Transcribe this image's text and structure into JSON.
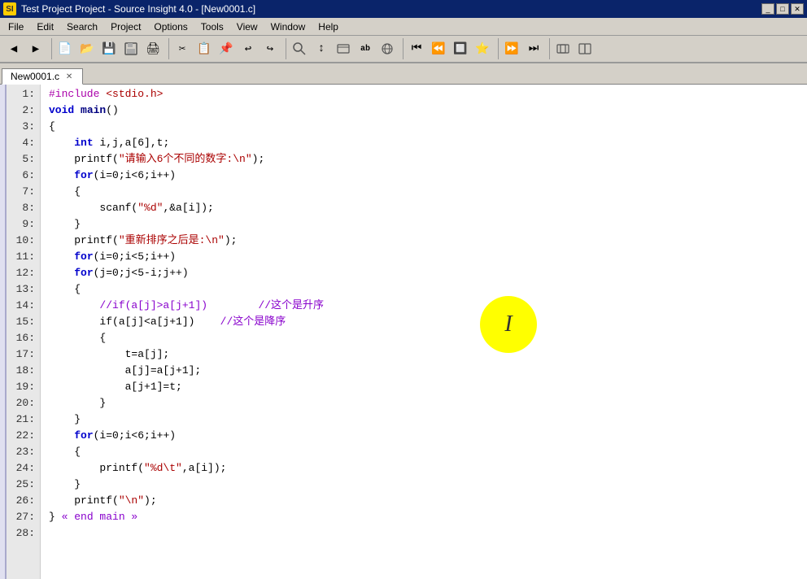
{
  "window": {
    "title": "Test Project Project - Source Insight 4.0 - [New0001.c]",
    "icon_label": "SI"
  },
  "menu": {
    "items": [
      "File",
      "Edit",
      "Search",
      "Project",
      "Options",
      "Tools",
      "View",
      "Window",
      "Help"
    ]
  },
  "tabs": [
    {
      "label": "New0001.c",
      "active": true
    }
  ],
  "toolbar": {
    "groups": [
      [
        "←",
        "→"
      ],
      [
        "📄",
        "📂",
        "💾",
        "📋",
        "🖨"
      ],
      [
        "✂",
        "📑",
        "📋",
        "↩",
        "↪"
      ],
      [
        "🔍",
        "↕",
        "📦",
        "ab",
        "🌐"
      ],
      [
        "⏮",
        "⏪",
        "🔲",
        "⭐",
        "⏭",
        "⏩"
      ]
    ]
  },
  "code": {
    "lines": [
      {
        "num": "1:",
        "tokens": [
          {
            "t": "#include ",
            "c": "macro"
          },
          {
            "t": "<stdio.h>",
            "c": "include-text"
          }
        ]
      },
      {
        "num": "2:",
        "tokens": [
          {
            "t": "void ",
            "c": "kw"
          },
          {
            "t": "main",
            "c": "fn"
          },
          {
            "t": "()",
            "c": "plain"
          }
        ]
      },
      {
        "num": "3:",
        "tokens": [
          {
            "t": "{",
            "c": "plain"
          }
        ]
      },
      {
        "num": "4:",
        "tokens": [
          {
            "t": "    int ",
            "c": "kw"
          },
          {
            "t": "i,j,a[6],t;",
            "c": "plain"
          }
        ]
      },
      {
        "num": "5:",
        "tokens": [
          {
            "t": "    printf(",
            "c": "plain"
          },
          {
            "t": "\"请输入6个不同的数字:\\n\"",
            "c": "str"
          },
          {
            "t": ");",
            "c": "plain"
          }
        ]
      },
      {
        "num": "6:",
        "tokens": [
          {
            "t": "    ",
            "c": "plain"
          },
          {
            "t": "for",
            "c": "kw"
          },
          {
            "t": "(i=0;i<6;i++)",
            "c": "plain"
          }
        ]
      },
      {
        "num": "7:",
        "tokens": [
          {
            "t": "    {",
            "c": "plain"
          }
        ]
      },
      {
        "num": "8:",
        "tokens": [
          {
            "t": "        scanf(",
            "c": "plain"
          },
          {
            "t": "\"\"",
            "c": "str"
          },
          {
            "t": ",&a[i]);",
            "c": "plain"
          }
        ]
      },
      {
        "num": "9:",
        "tokens": [
          {
            "t": "    }",
            "c": "plain"
          }
        ]
      },
      {
        "num": "10:",
        "tokens": [
          {
            "t": "    printf(",
            "c": "plain"
          },
          {
            "t": "\"重新排序之后是:\\n\"",
            "c": "str"
          },
          {
            "t": ");",
            "c": "plain"
          }
        ]
      },
      {
        "num": "11:",
        "tokens": [
          {
            "t": "    ",
            "c": "plain"
          },
          {
            "t": "for",
            "c": "kw"
          },
          {
            "t": "(i=0;i<5;i++)",
            "c": "plain"
          }
        ]
      },
      {
        "num": "12:",
        "tokens": [
          {
            "t": "    ",
            "c": "plain"
          },
          {
            "t": "for",
            "c": "kw"
          },
          {
            "t": "(j=0;j<5-i;j++)",
            "c": "plain"
          }
        ]
      },
      {
        "num": "13:",
        "tokens": [
          {
            "t": "    {",
            "c": "plain"
          }
        ]
      },
      {
        "num": "14:",
        "tokens": [
          {
            "t": "        ",
            "c": "plain"
          },
          {
            "t": "//if(a[j]>a[j+1])        //这个是升序",
            "c": "cmt"
          }
        ]
      },
      {
        "num": "15:",
        "tokens": [
          {
            "t": "        if(a[j]<a[j+1])    ",
            "c": "plain"
          },
          {
            "t": "//这个是降序",
            "c": "cmt"
          }
        ]
      },
      {
        "num": "16:",
        "tokens": [
          {
            "t": "        {",
            "c": "plain"
          }
        ]
      },
      {
        "num": "17:",
        "tokens": [
          {
            "t": "            t=a[j];",
            "c": "plain"
          }
        ]
      },
      {
        "num": "18:",
        "tokens": [
          {
            "t": "            a[j]=a[j+1];",
            "c": "plain"
          }
        ]
      },
      {
        "num": "19:",
        "tokens": [
          {
            "t": "            a[j+1]=t;",
            "c": "plain"
          }
        ]
      },
      {
        "num": "20:",
        "tokens": [
          {
            "t": "        }",
            "c": "plain"
          }
        ]
      },
      {
        "num": "21:",
        "tokens": [
          {
            "t": "    }",
            "c": "plain"
          }
        ]
      },
      {
        "num": "22:",
        "tokens": [
          {
            "t": "    ",
            "c": "plain"
          },
          {
            "t": "for",
            "c": "kw"
          },
          {
            "t": "(i=0;i<6;i++)",
            "c": "plain"
          }
        ]
      },
      {
        "num": "23:",
        "tokens": [
          {
            "t": "    {",
            "c": "plain"
          }
        ]
      },
      {
        "num": "24:",
        "tokens": [
          {
            "t": "        printf(",
            "c": "plain"
          },
          {
            "t": "\"%d\\t\"",
            "c": "str"
          },
          {
            "t": ",a[i]);",
            "c": "plain"
          }
        ]
      },
      {
        "num": "25:",
        "tokens": [
          {
            "t": "    }",
            "c": "plain"
          }
        ]
      },
      {
        "num": "26:",
        "tokens": [
          {
            "t": "    printf(",
            "c": "plain"
          },
          {
            "t": "\"\\n\"",
            "c": "str"
          },
          {
            "t": ");",
            "c": "plain"
          }
        ]
      },
      {
        "num": "27:",
        "tokens": [
          {
            "t": "} ",
            "c": "plain"
          },
          {
            "t": "« end main »",
            "c": "cmt"
          }
        ]
      },
      {
        "num": "28:",
        "tokens": [
          {
            "t": "",
            "c": "plain"
          }
        ]
      }
    ]
  },
  "cursor_label": "I"
}
